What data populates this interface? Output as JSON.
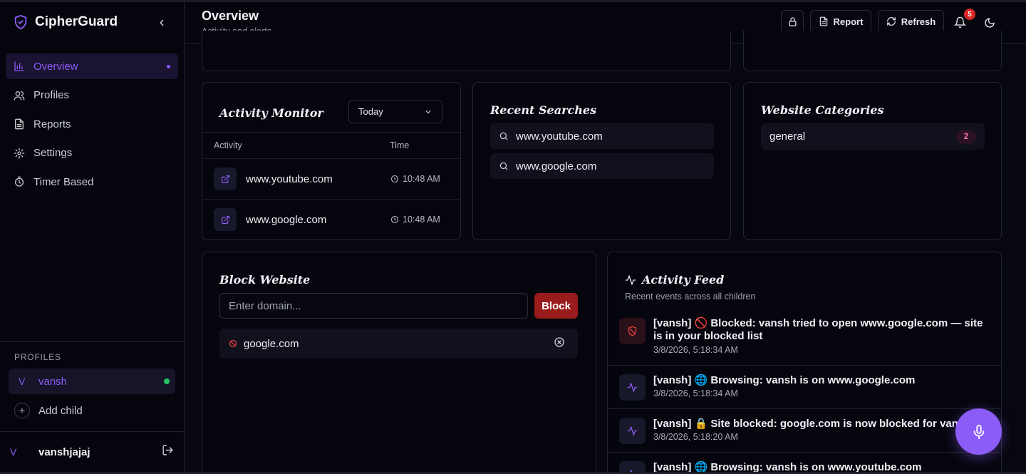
{
  "app": {
    "title": "CipherGuard"
  },
  "sidebar": {
    "items": [
      {
        "label": "Overview",
        "icon": "bar-chart-icon",
        "active": true
      },
      {
        "label": "Profiles",
        "icon": "users-icon"
      },
      {
        "label": "Reports",
        "icon": "document-icon"
      },
      {
        "label": "Settings",
        "icon": "gear-icon"
      },
      {
        "label": "Timer Based",
        "icon": "timer-icon"
      }
    ],
    "profiles_heading": "PROFILES",
    "profiles": [
      {
        "initial": "V",
        "name": "vansh",
        "status": "online"
      }
    ],
    "add_child_label": "Add child",
    "user": {
      "initial": "V",
      "name": "vanshjajaj"
    }
  },
  "header": {
    "title": "Overview",
    "subtitle": "Activity and alerts",
    "report_label": "Report",
    "refresh_label": "Refresh",
    "notification_count": "5"
  },
  "activity_monitor": {
    "title": "Activity Monitor",
    "filter_value": "Today",
    "columns": {
      "activity": "Activity",
      "time": "Time"
    },
    "rows": [
      {
        "site": "www.youtube.com",
        "time": "10:48 AM"
      },
      {
        "site": "www.google.com",
        "time": "10:48 AM"
      }
    ]
  },
  "recent_searches": {
    "title": "Recent Searches",
    "items": [
      "www.youtube.com",
      "www.google.com"
    ]
  },
  "website_categories": {
    "title": "Website Categories",
    "items": [
      {
        "name": "general",
        "count": "2"
      }
    ]
  },
  "block_website": {
    "title": "Block Website",
    "input_placeholder": "Enter domain...",
    "button_label": "Block",
    "blocked": [
      "google.com"
    ]
  },
  "activity_feed": {
    "title": "Activity Feed",
    "subtitle": "Recent events across all children",
    "events": [
      {
        "type": "blocked",
        "text": "[vansh] 🚫 Blocked: vansh tried to open www.google.com — site is in your blocked list",
        "time": "3/8/2026, 5:18:34 AM"
      },
      {
        "type": "activity",
        "text": "[vansh] 🌐 Browsing: vansh is on www.google.com",
        "time": "3/8/2026, 5:18:34 AM"
      },
      {
        "type": "activity",
        "text": "[vansh] 🔒 Site blocked: google.com is now blocked for vansh",
        "time": "3/8/2026, 5:18:20 AM"
      },
      {
        "type": "activity",
        "text": "[vansh] 🌐 Browsing: vansh is on www.youtube.com",
        "time": ""
      }
    ]
  },
  "colors": {
    "accent": "#8b5cf6",
    "danger": "#991b1b",
    "online": "#22c55e",
    "background": "#06070f"
  }
}
